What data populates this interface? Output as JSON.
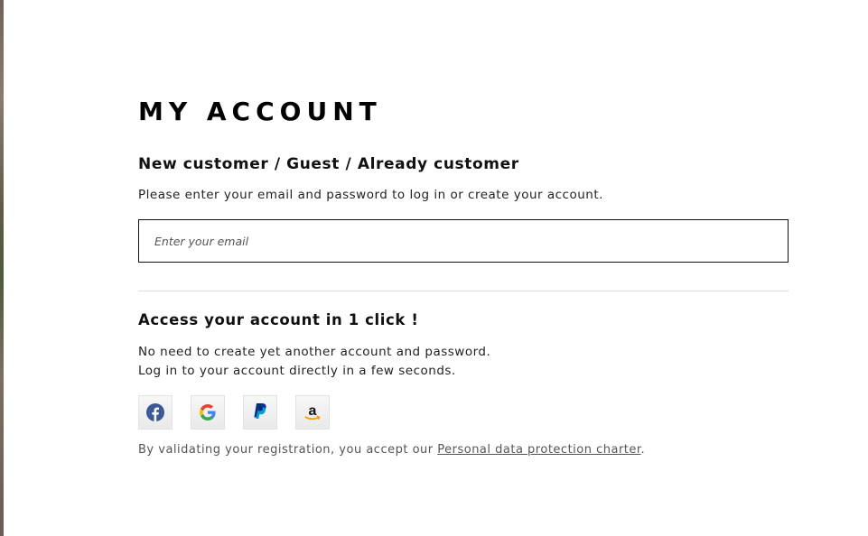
{
  "page": {
    "title": "MY ACCOUNT",
    "subtitle": "New customer / Guest / Already customer",
    "intro": "Please enter your email and password to log in or create your account."
  },
  "email": {
    "placeholder": "Enter your email",
    "value": ""
  },
  "social": {
    "title": "Access your account in 1 click !",
    "desc_line1": "No need to create yet another account and password.",
    "desc_line2": "Log in to your account directly in a few seconds.",
    "providers": [
      {
        "name": "Facebook",
        "icon": "facebook-icon",
        "color": "#3b5998"
      },
      {
        "name": "Google",
        "icon": "google-icon",
        "color": "#4285f4"
      },
      {
        "name": "PayPal",
        "icon": "paypal-icon",
        "color": "#003087"
      },
      {
        "name": "Amazon",
        "icon": "amazon-icon",
        "color": "#ff9900"
      }
    ]
  },
  "legal": {
    "prefix": "By validating your registration, you accept our ",
    "link": "Personal data protection charter",
    "suffix": "."
  }
}
